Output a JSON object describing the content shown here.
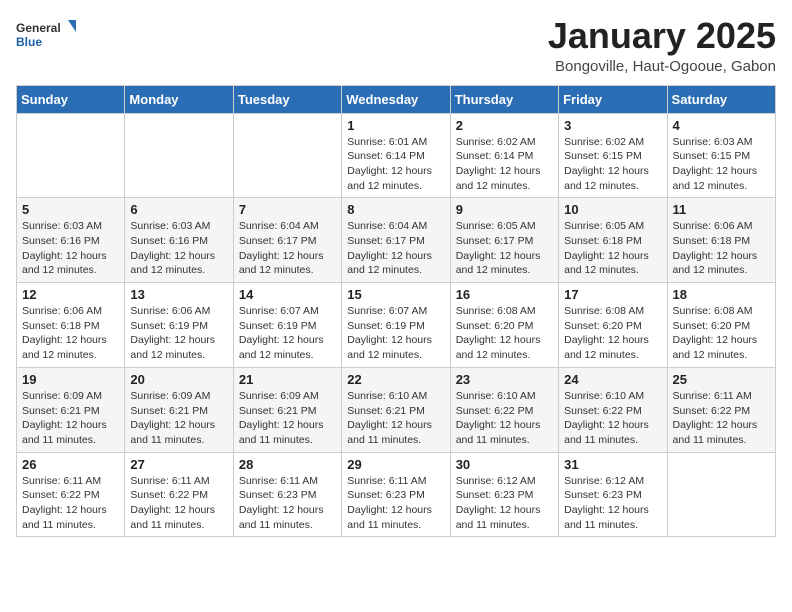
{
  "header": {
    "logo_general": "General",
    "logo_blue": "Blue",
    "month_title": "January 2025",
    "location": "Bongoville, Haut-Ogooue, Gabon"
  },
  "weekdays": [
    "Sunday",
    "Monday",
    "Tuesday",
    "Wednesday",
    "Thursday",
    "Friday",
    "Saturday"
  ],
  "weeks": [
    [
      {
        "day": "",
        "info": ""
      },
      {
        "day": "",
        "info": ""
      },
      {
        "day": "",
        "info": ""
      },
      {
        "day": "1",
        "info": "Sunrise: 6:01 AM\nSunset: 6:14 PM\nDaylight: 12 hours\nand 12 minutes."
      },
      {
        "day": "2",
        "info": "Sunrise: 6:02 AM\nSunset: 6:14 PM\nDaylight: 12 hours\nand 12 minutes."
      },
      {
        "day": "3",
        "info": "Sunrise: 6:02 AM\nSunset: 6:15 PM\nDaylight: 12 hours\nand 12 minutes."
      },
      {
        "day": "4",
        "info": "Sunrise: 6:03 AM\nSunset: 6:15 PM\nDaylight: 12 hours\nand 12 minutes."
      }
    ],
    [
      {
        "day": "5",
        "info": "Sunrise: 6:03 AM\nSunset: 6:16 PM\nDaylight: 12 hours\nand 12 minutes."
      },
      {
        "day": "6",
        "info": "Sunrise: 6:03 AM\nSunset: 6:16 PM\nDaylight: 12 hours\nand 12 minutes."
      },
      {
        "day": "7",
        "info": "Sunrise: 6:04 AM\nSunset: 6:17 PM\nDaylight: 12 hours\nand 12 minutes."
      },
      {
        "day": "8",
        "info": "Sunrise: 6:04 AM\nSunset: 6:17 PM\nDaylight: 12 hours\nand 12 minutes."
      },
      {
        "day": "9",
        "info": "Sunrise: 6:05 AM\nSunset: 6:17 PM\nDaylight: 12 hours\nand 12 minutes."
      },
      {
        "day": "10",
        "info": "Sunrise: 6:05 AM\nSunset: 6:18 PM\nDaylight: 12 hours\nand 12 minutes."
      },
      {
        "day": "11",
        "info": "Sunrise: 6:06 AM\nSunset: 6:18 PM\nDaylight: 12 hours\nand 12 minutes."
      }
    ],
    [
      {
        "day": "12",
        "info": "Sunrise: 6:06 AM\nSunset: 6:18 PM\nDaylight: 12 hours\nand 12 minutes."
      },
      {
        "day": "13",
        "info": "Sunrise: 6:06 AM\nSunset: 6:19 PM\nDaylight: 12 hours\nand 12 minutes."
      },
      {
        "day": "14",
        "info": "Sunrise: 6:07 AM\nSunset: 6:19 PM\nDaylight: 12 hours\nand 12 minutes."
      },
      {
        "day": "15",
        "info": "Sunrise: 6:07 AM\nSunset: 6:19 PM\nDaylight: 12 hours\nand 12 minutes."
      },
      {
        "day": "16",
        "info": "Sunrise: 6:08 AM\nSunset: 6:20 PM\nDaylight: 12 hours\nand 12 minutes."
      },
      {
        "day": "17",
        "info": "Sunrise: 6:08 AM\nSunset: 6:20 PM\nDaylight: 12 hours\nand 12 minutes."
      },
      {
        "day": "18",
        "info": "Sunrise: 6:08 AM\nSunset: 6:20 PM\nDaylight: 12 hours\nand 12 minutes."
      }
    ],
    [
      {
        "day": "19",
        "info": "Sunrise: 6:09 AM\nSunset: 6:21 PM\nDaylight: 12 hours\nand 11 minutes."
      },
      {
        "day": "20",
        "info": "Sunrise: 6:09 AM\nSunset: 6:21 PM\nDaylight: 12 hours\nand 11 minutes."
      },
      {
        "day": "21",
        "info": "Sunrise: 6:09 AM\nSunset: 6:21 PM\nDaylight: 12 hours\nand 11 minutes."
      },
      {
        "day": "22",
        "info": "Sunrise: 6:10 AM\nSunset: 6:21 PM\nDaylight: 12 hours\nand 11 minutes."
      },
      {
        "day": "23",
        "info": "Sunrise: 6:10 AM\nSunset: 6:22 PM\nDaylight: 12 hours\nand 11 minutes."
      },
      {
        "day": "24",
        "info": "Sunrise: 6:10 AM\nSunset: 6:22 PM\nDaylight: 12 hours\nand 11 minutes."
      },
      {
        "day": "25",
        "info": "Sunrise: 6:11 AM\nSunset: 6:22 PM\nDaylight: 12 hours\nand 11 minutes."
      }
    ],
    [
      {
        "day": "26",
        "info": "Sunrise: 6:11 AM\nSunset: 6:22 PM\nDaylight: 12 hours\nand 11 minutes."
      },
      {
        "day": "27",
        "info": "Sunrise: 6:11 AM\nSunset: 6:22 PM\nDaylight: 12 hours\nand 11 minutes."
      },
      {
        "day": "28",
        "info": "Sunrise: 6:11 AM\nSunset: 6:23 PM\nDaylight: 12 hours\nand 11 minutes."
      },
      {
        "day": "29",
        "info": "Sunrise: 6:11 AM\nSunset: 6:23 PM\nDaylight: 12 hours\nand 11 minutes."
      },
      {
        "day": "30",
        "info": "Sunrise: 6:12 AM\nSunset: 6:23 PM\nDaylight: 12 hours\nand 11 minutes."
      },
      {
        "day": "31",
        "info": "Sunrise: 6:12 AM\nSunset: 6:23 PM\nDaylight: 12 hours\nand 11 minutes."
      },
      {
        "day": "",
        "info": ""
      }
    ]
  ]
}
